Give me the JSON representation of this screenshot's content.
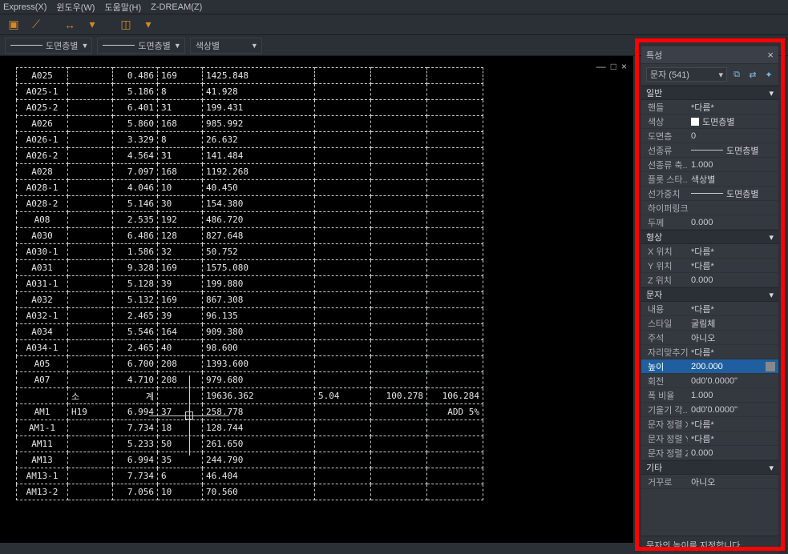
{
  "menu": {
    "items": [
      "Express(X)",
      "윈도우(W)",
      "도움말(H)",
      "Z-DREAM(Z)"
    ]
  },
  "toolbar": {
    "line_layer_label": "도면층별",
    "color_label": "색상별"
  },
  "doc_controls": {
    "min": "—",
    "max": "□",
    "close": "×"
  },
  "chart_data": {
    "type": "table",
    "rows": [
      [
        "A025",
        "",
        "0.486",
        "169",
        "1425.848",
        "",
        "",
        ""
      ],
      [
        "A025-1",
        "",
        "5.186",
        "8",
        "41.928",
        "",
        "",
        ""
      ],
      [
        "A025-2",
        "",
        "6.401",
        "31",
        "199.431",
        "",
        "",
        ""
      ],
      [
        "A026",
        "",
        "5.860",
        "168",
        "985.992",
        "",
        "",
        ""
      ],
      [
        "A026-1",
        "",
        "3.329",
        "8",
        "26.632",
        "",
        "",
        ""
      ],
      [
        "A026-2",
        "",
        "4.564",
        "31",
        "141.484",
        "",
        "",
        ""
      ],
      [
        "A028",
        "",
        "7.097",
        "168",
        "1192.268",
        "",
        "",
        ""
      ],
      [
        "A028-1",
        "",
        "4.046",
        "10",
        "40.450",
        "",
        "",
        ""
      ],
      [
        "A028-2",
        "",
        "5.146",
        "30",
        "154.380",
        "",
        "",
        ""
      ],
      [
        "A08",
        "",
        "2.535",
        "192",
        "486.720",
        "",
        "",
        ""
      ],
      [
        "A030",
        "",
        "6.486",
        "128",
        "827.648",
        "",
        "",
        ""
      ],
      [
        "A030-1",
        "",
        "1.586",
        "32",
        "50.752",
        "",
        "",
        ""
      ],
      [
        "A031",
        "",
        "9.328",
        "169",
        "1575.080",
        "",
        "",
        ""
      ],
      [
        "A031-1",
        "",
        "5.128",
        "39",
        "199.880",
        "",
        "",
        ""
      ],
      [
        "A032",
        "",
        "5.132",
        "169",
        "867.308",
        "",
        "",
        ""
      ],
      [
        "A032-1",
        "",
        "2.465",
        "39",
        "96.135",
        "",
        "",
        ""
      ],
      [
        "A034",
        "",
        "5.546",
        "164",
        "909.380",
        "",
        "",
        ""
      ],
      [
        "A034-1",
        "",
        "2.465",
        "40",
        "98.600",
        "",
        "",
        ""
      ],
      [
        "A05",
        "",
        "6.700",
        "208",
        "1393.600",
        "",
        "",
        ""
      ],
      [
        "A07",
        "",
        "4.710",
        "208",
        "979.680",
        "",
        "",
        ""
      ],
      [
        "",
        "소",
        "계",
        "",
        "19636.362",
        "5.04",
        "100.278",
        "106.284"
      ],
      [
        "AM1",
        "H19",
        "6.994",
        "37",
        "258.778",
        "",
        "",
        "ADD 5%"
      ],
      [
        "AM1-1",
        "",
        "7.734",
        "18",
        "128.744",
        "",
        "",
        ""
      ],
      [
        "AM11",
        "",
        "5.233",
        "50",
        "261.650",
        "",
        "",
        ""
      ],
      [
        "AM13",
        "",
        "6.994",
        "35",
        "244.790",
        "",
        "",
        ""
      ],
      [
        "AM13-1",
        "",
        "7.734",
        "6",
        "46.404",
        "",
        "",
        ""
      ],
      [
        "AM13-2",
        "",
        "7.056",
        "10",
        "70.560",
        "",
        "",
        ""
      ]
    ]
  },
  "props": {
    "title": "특성",
    "selector": "문자 (541)",
    "sections": {
      "general": {
        "title": "일반",
        "rows": [
          {
            "k": "핸들",
            "v": "*다름*"
          },
          {
            "k": "색상",
            "v": "도면층별",
            "swatch": true
          },
          {
            "k": "도면층",
            "v": "0"
          },
          {
            "k": "선종류",
            "v": "도면층별",
            "line": true
          },
          {
            "k": "선종류 축...",
            "v": "1.000"
          },
          {
            "k": "플롯 스타...",
            "v": "색상별"
          },
          {
            "k": "선가중치",
            "v": "도면층별",
            "line": true
          },
          {
            "k": "하이퍼링크",
            "v": ""
          },
          {
            "k": "두께",
            "v": "0.000"
          }
        ]
      },
      "geom": {
        "title": "형상",
        "rows": [
          {
            "k": "X 위치",
            "v": "*다름*"
          },
          {
            "k": "Y 위치",
            "v": "*다름*"
          },
          {
            "k": "Z 위치",
            "v": "0.000"
          }
        ]
      },
      "text": {
        "title": "문자",
        "rows": [
          {
            "k": "내용",
            "v": "*다름*"
          },
          {
            "k": "스타일",
            "v": "굴림체"
          },
          {
            "k": "주석",
            "v": "아니오"
          },
          {
            "k": "자리맞추기",
            "v": "*다름*"
          },
          {
            "k": "높이",
            "v": "200.000",
            "hi": true,
            "calc": true
          },
          {
            "k": "회전",
            "v": "0d0'0.0000\""
          },
          {
            "k": "폭 비율",
            "v": "1.000"
          },
          {
            "k": "기울기 각...",
            "v": "0d0'0.0000\""
          },
          {
            "k": "문자 정렬 X",
            "v": "*다름*"
          },
          {
            "k": "문자 정렬 Y",
            "v": "*다름*"
          },
          {
            "k": "문자 정렬 Z",
            "v": "0.000"
          }
        ]
      },
      "misc": {
        "title": "기타",
        "rows": [
          {
            "k": "거꾸로",
            "v": "아니오"
          }
        ]
      }
    }
  },
  "status": "문자의 높이를 지정합니다."
}
